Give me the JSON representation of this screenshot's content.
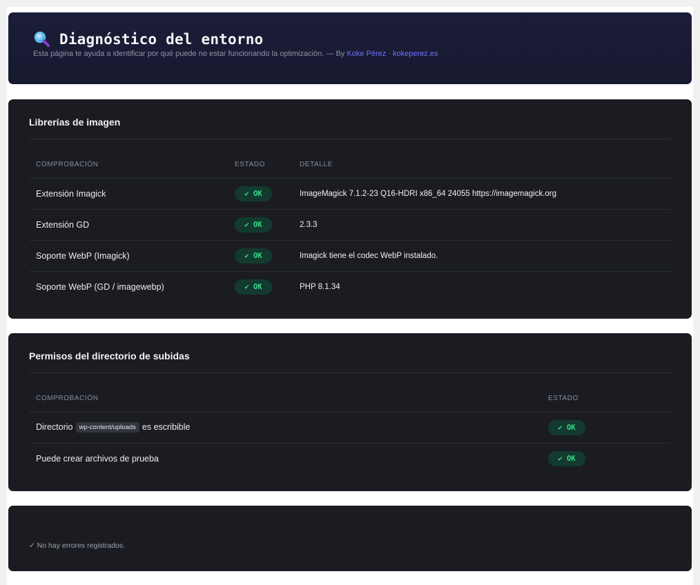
{
  "header": {
    "title": "Diagnóstico del entorno",
    "subtitle": "Esta página te ayuda a identificar por qué puede no estar funcionando la optimización. — By",
    "author_link": "Koke Pérez",
    "separator": "·",
    "site_link": "kokeperez.es"
  },
  "libraries": {
    "title": "Librerías de imagen",
    "columns": [
      "COMPROBACIÓN",
      "ESTADO",
      "DETALLE"
    ],
    "rows": [
      {
        "check": "Extensión Imagick",
        "status": "✔ OK",
        "detail": "ImageMagick 7.1.2-23 Q16-HDRI x86_64 24055 https://imagemagick.org"
      },
      {
        "check": "Extensión GD",
        "status": "✔ OK",
        "detail": "2.3.3"
      },
      {
        "check": "Soporte WebP (Imagick)",
        "status": "✔ OK",
        "detail": "Imagick tiene el codec WebP instalado."
      },
      {
        "check": "Soporte WebP (GD / imagewebp)",
        "status": "✔ OK",
        "detail": "PHP 8.1.34"
      }
    ]
  },
  "permissions": {
    "title": "Permisos del directorio de subidas",
    "columns": [
      "COMPROBACIÓN",
      "ESTADO"
    ],
    "rows": [
      {
        "check_prefix": "Directorio",
        "check_code": "wp-content/uploads",
        "check_suffix": "es escribible",
        "status": "✔ OK"
      },
      {
        "check": "Puede crear archivos de prueba",
        "status": "✔ OK"
      }
    ]
  },
  "errors": {
    "message": "✓ No hay errores registrados."
  },
  "colors": {
    "ok_text": "#39d98a",
    "ok_bg": "#133a2f",
    "link": "#6f73ff",
    "card_bg": "#1b1c22",
    "header_bg": "#1c1d38"
  },
  "icons": {
    "header": "magnifier-icon"
  }
}
